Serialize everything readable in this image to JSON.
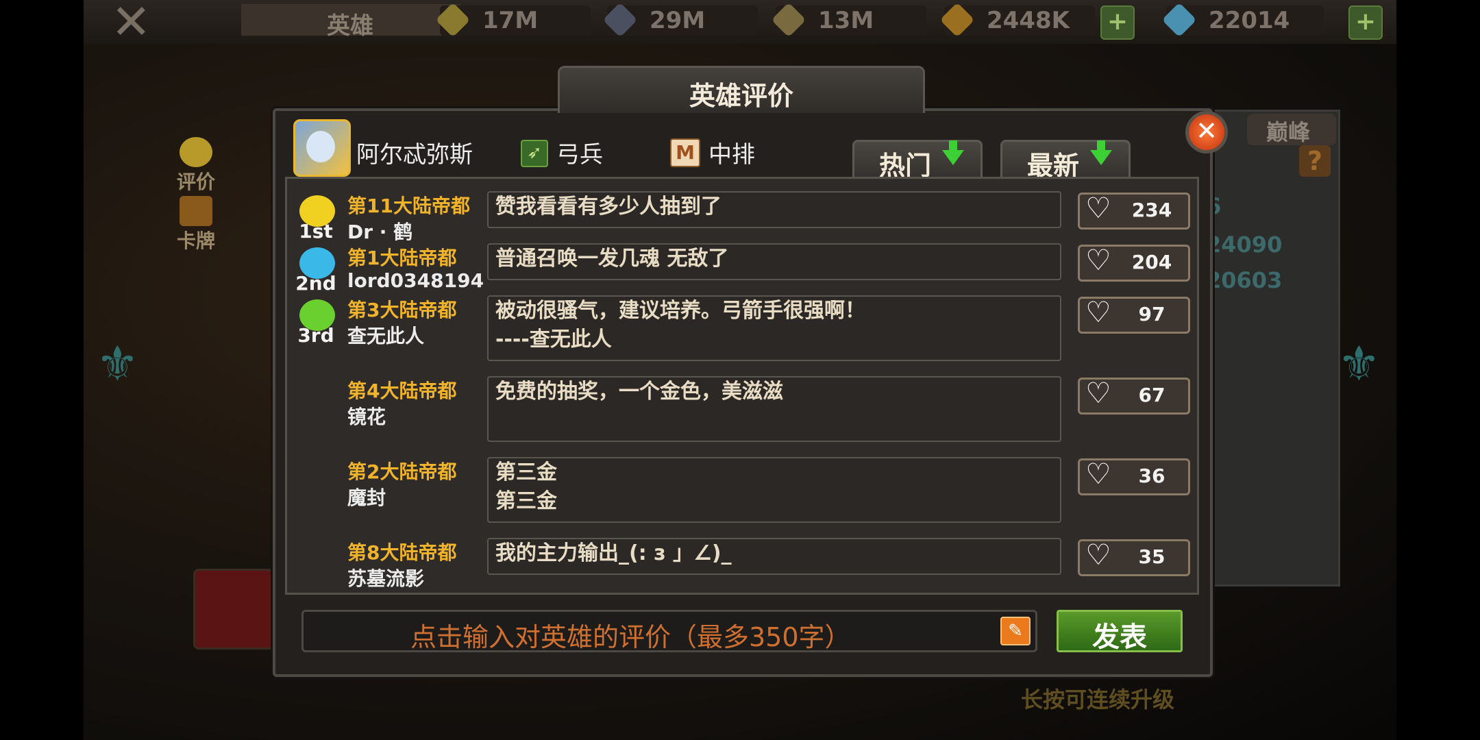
{
  "topbar": {
    "hero_tab": "英雄",
    "resources": [
      {
        "name": "resource-1",
        "value": "17M",
        "color": "#8a7a30"
      },
      {
        "name": "resource-2",
        "value": "29M",
        "color": "#4a5060"
      },
      {
        "name": "resource-3",
        "value": "13M",
        "color": "#7a6a40"
      },
      {
        "name": "resource-4",
        "value": "2448K",
        "color": "#9a7020"
      },
      {
        "name": "diamond",
        "value": "22014",
        "color": "#4a90b0"
      }
    ]
  },
  "sidebar": {
    "items": [
      {
        "label": "评价"
      },
      {
        "label": "卡牌"
      }
    ]
  },
  "right_panel": {
    "tab": "巅峰",
    "numbers": [
      "6",
      "24090",
      "20603"
    ],
    "hint": "长按可连续升级"
  },
  "dialog": {
    "title": "英雄评价",
    "hero_name": "阿尔忒弥斯",
    "hero_class": "弓兵",
    "hero_position": "中排",
    "position_icon_letter": "M",
    "sort_tabs": [
      {
        "label": "热门"
      },
      {
        "label": "最新"
      }
    ],
    "comments": [
      {
        "rank": "1st",
        "rank_color": "#f0d020",
        "server": "第11大陆帝都",
        "user": "Dr · 鹤",
        "lines": [
          "赞我看看有多少人抽到了"
        ],
        "likes": "234"
      },
      {
        "rank": "2nd",
        "rank_color": "#3ab8e8",
        "server": "第1大陆帝都",
        "user": "lord0348194",
        "lines": [
          "普通召唤一发几魂  无敌了"
        ],
        "likes": "204"
      },
      {
        "rank": "3rd",
        "rank_color": "#6ad030",
        "server": "第3大陆帝都",
        "user": "查无此人",
        "lines": [
          "被动很骚气，建议培养。弓箭手很强啊！",
          "----查无此人"
        ],
        "likes": "97"
      },
      {
        "rank": "",
        "rank_color": "",
        "server": "第4大陆帝都",
        "user": "镜花",
        "lines": [
          "免费的抽奖，一个金色，美滋滋",
          ""
        ],
        "likes": "67"
      },
      {
        "rank": "",
        "rank_color": "",
        "server": "第2大陆帝都",
        "user": "魔封",
        "lines": [
          "第三金",
          "第三金"
        ],
        "likes": "36"
      },
      {
        "rank": "",
        "rank_color": "",
        "server": "第8大陆帝都",
        "user": "苏墓流影",
        "lines": [
          "我的主力输出_(: з 」∠)_"
        ],
        "likes": "35"
      }
    ],
    "input_placeholder": "点击输入对英雄的评价（最多350字）",
    "submit_label": "发表"
  }
}
